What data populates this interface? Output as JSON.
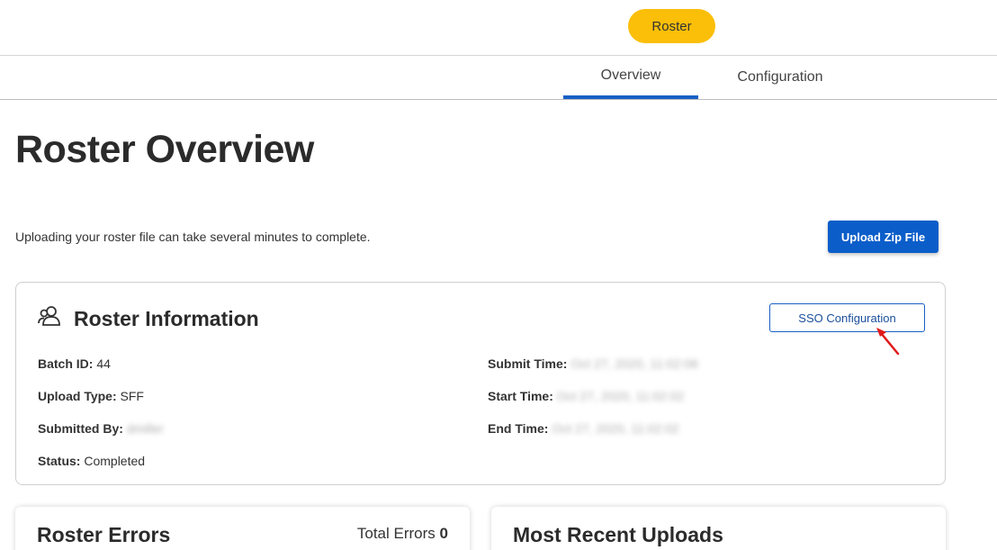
{
  "header": {
    "module_label": "Roster"
  },
  "tabs": [
    {
      "label": "Overview",
      "active": true
    },
    {
      "label": "Configuration",
      "active": false
    }
  ],
  "page": {
    "title": "Roster Overview",
    "intro": "Uploading your roster file can take several minutes to complete.",
    "upload_button": "Upload Zip File"
  },
  "roster_info": {
    "title": "Roster Information",
    "icon": "users-icon",
    "sso_button": "SSO Configuration",
    "left_fields": [
      {
        "label": "Batch ID:",
        "value": "44",
        "redacted": false
      },
      {
        "label": "Upload Type:",
        "value": "SFF",
        "redacted": false
      },
      {
        "label": "Submitted By:",
        "value": "dmiller",
        "redacted": true
      },
      {
        "label": "Status:",
        "value": "Completed",
        "redacted": false
      }
    ],
    "right_fields": [
      {
        "label": "Submit Time:",
        "value": "Oct 27, 2020, 11:02:08",
        "redacted": true
      },
      {
        "label": "Start Time:",
        "value": "Oct 27, 2020, 11:02:02",
        "redacted": true
      },
      {
        "label": "End Time:",
        "value": "Oct 27, 2020, 11:02:02",
        "redacted": true
      }
    ]
  },
  "roster_errors": {
    "title": "Roster Errors",
    "total_label": "Total Errors",
    "total_value": "0"
  },
  "recent_uploads": {
    "title": "Most Recent Uploads"
  },
  "colors": {
    "accent": "#0b5ec9",
    "pill": "#fbbf0a",
    "tab_underline": "#1660c4",
    "annotation_arrow": "#e01b1b"
  }
}
